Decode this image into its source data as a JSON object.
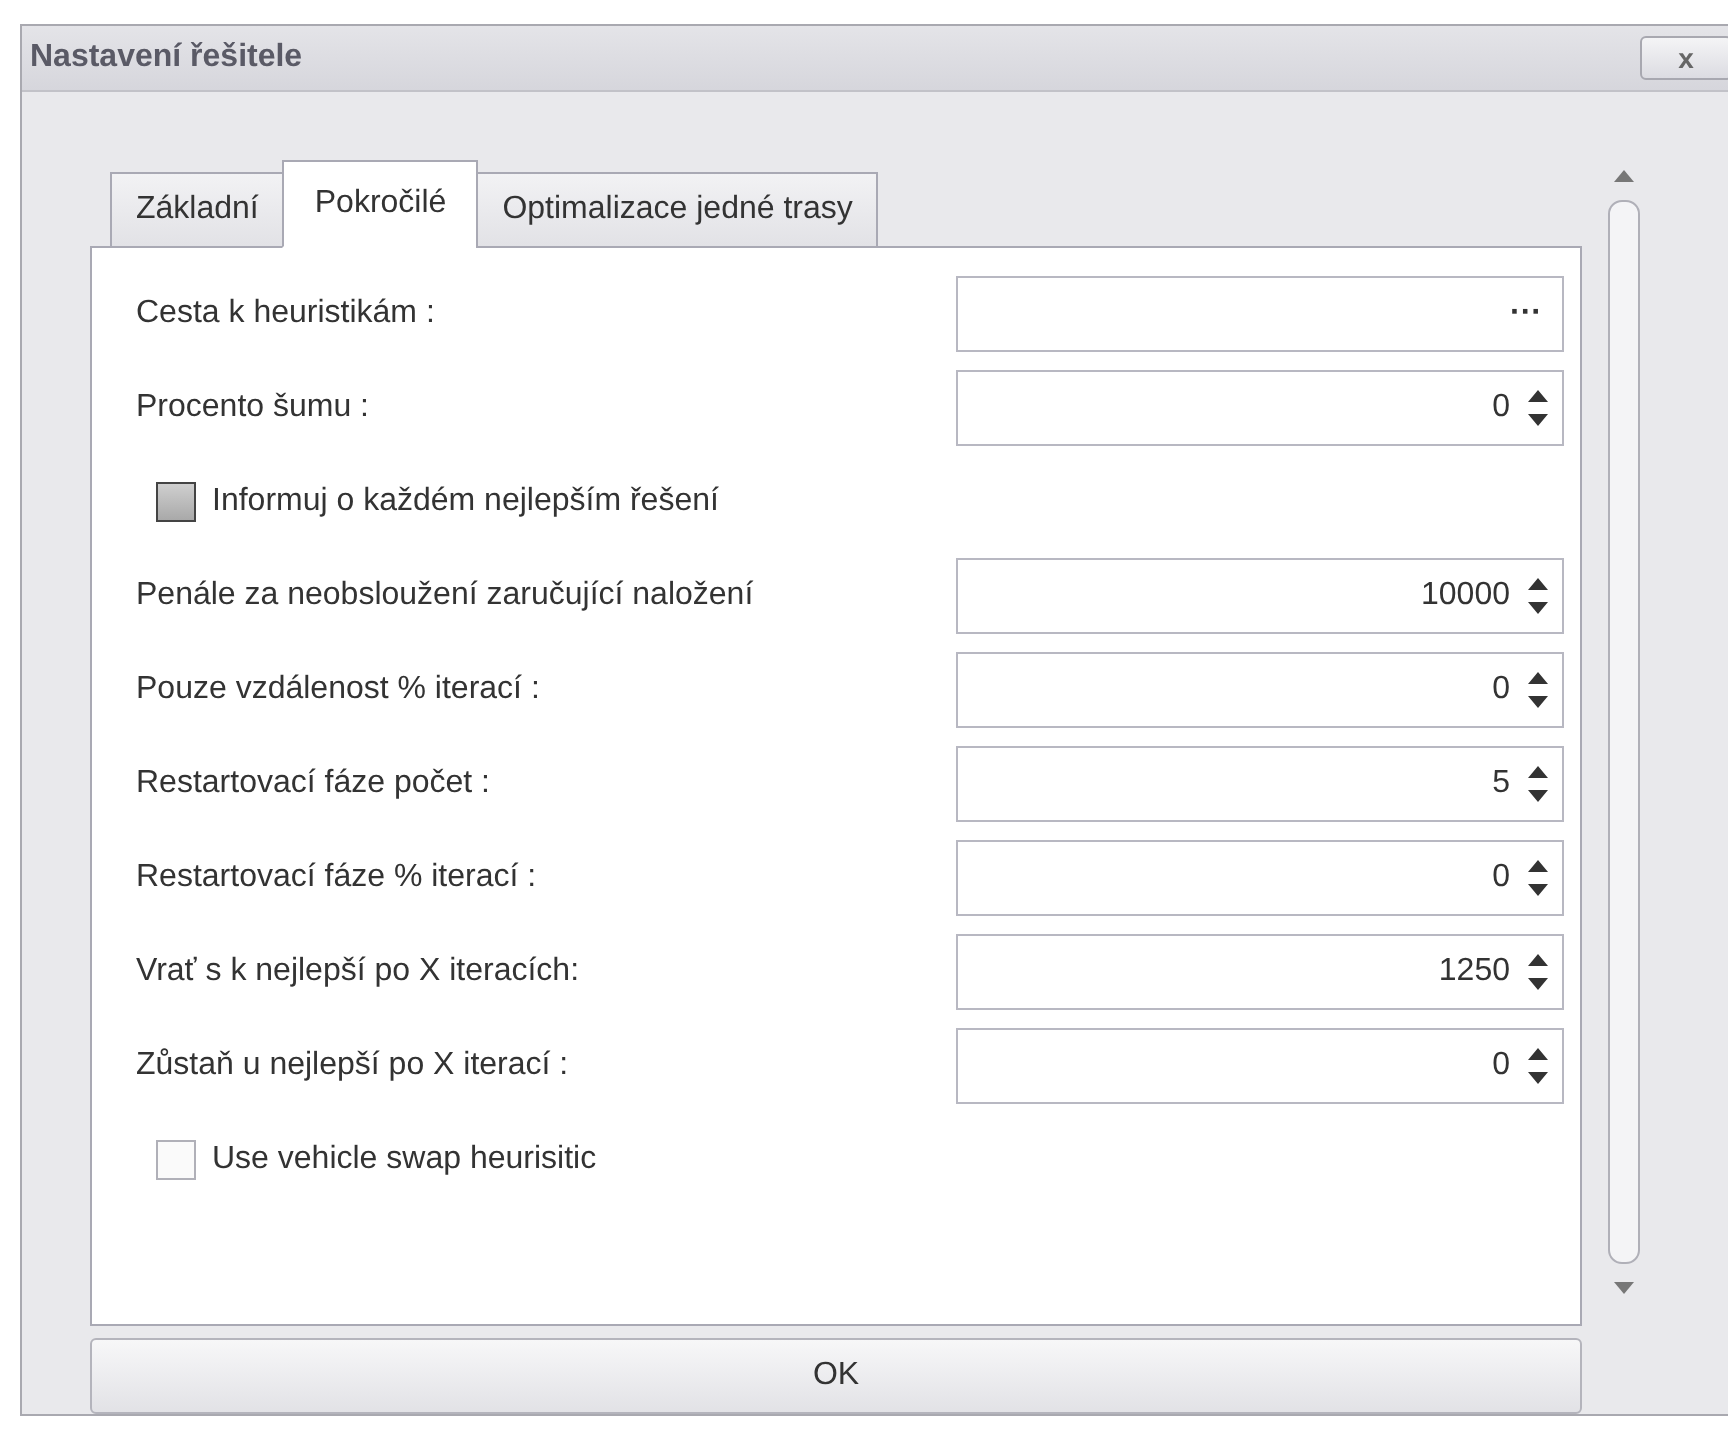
{
  "window": {
    "title": "Nastavení řešitele",
    "close": "x"
  },
  "tabs": [
    {
      "label": "Základní",
      "selected": false
    },
    {
      "label": "Pokročilé",
      "selected": true
    },
    {
      "label": "Optimalizace jedné trasy",
      "selected": false
    }
  ],
  "rows": [
    {
      "kind": "browse",
      "label": "Cesta k heuristikám :",
      "button": "···"
    },
    {
      "kind": "spin",
      "label": "Procento šumu :",
      "value": "0"
    },
    {
      "kind": "checkbox",
      "label": "Informuj o každém nejlepším řešení",
      "checked": false,
      "indeterminate": true
    },
    {
      "kind": "spin",
      "label": "Penále za neobsloužení zaručující naložení",
      "value": "10000"
    },
    {
      "kind": "spin",
      "label": "Pouze vzdálenost % iterací :",
      "value": "0"
    },
    {
      "kind": "spin",
      "label": "Restartovací fáze počet :",
      "value": "5"
    },
    {
      "kind": "spin",
      "label": "Restartovací fáze % iterací :",
      "value": "0"
    },
    {
      "kind": "spin",
      "label": "Vrať s k nejlepší po X iteracích:",
      "value": "1250"
    },
    {
      "kind": "spin",
      "label": "Zůstaň u nejlepší po X iterací :",
      "value": "0"
    },
    {
      "kind": "checkbox",
      "label": "Use vehicle swap heurisitic",
      "checked": false,
      "indeterminate": false
    }
  ],
  "ok_button": "OK"
}
